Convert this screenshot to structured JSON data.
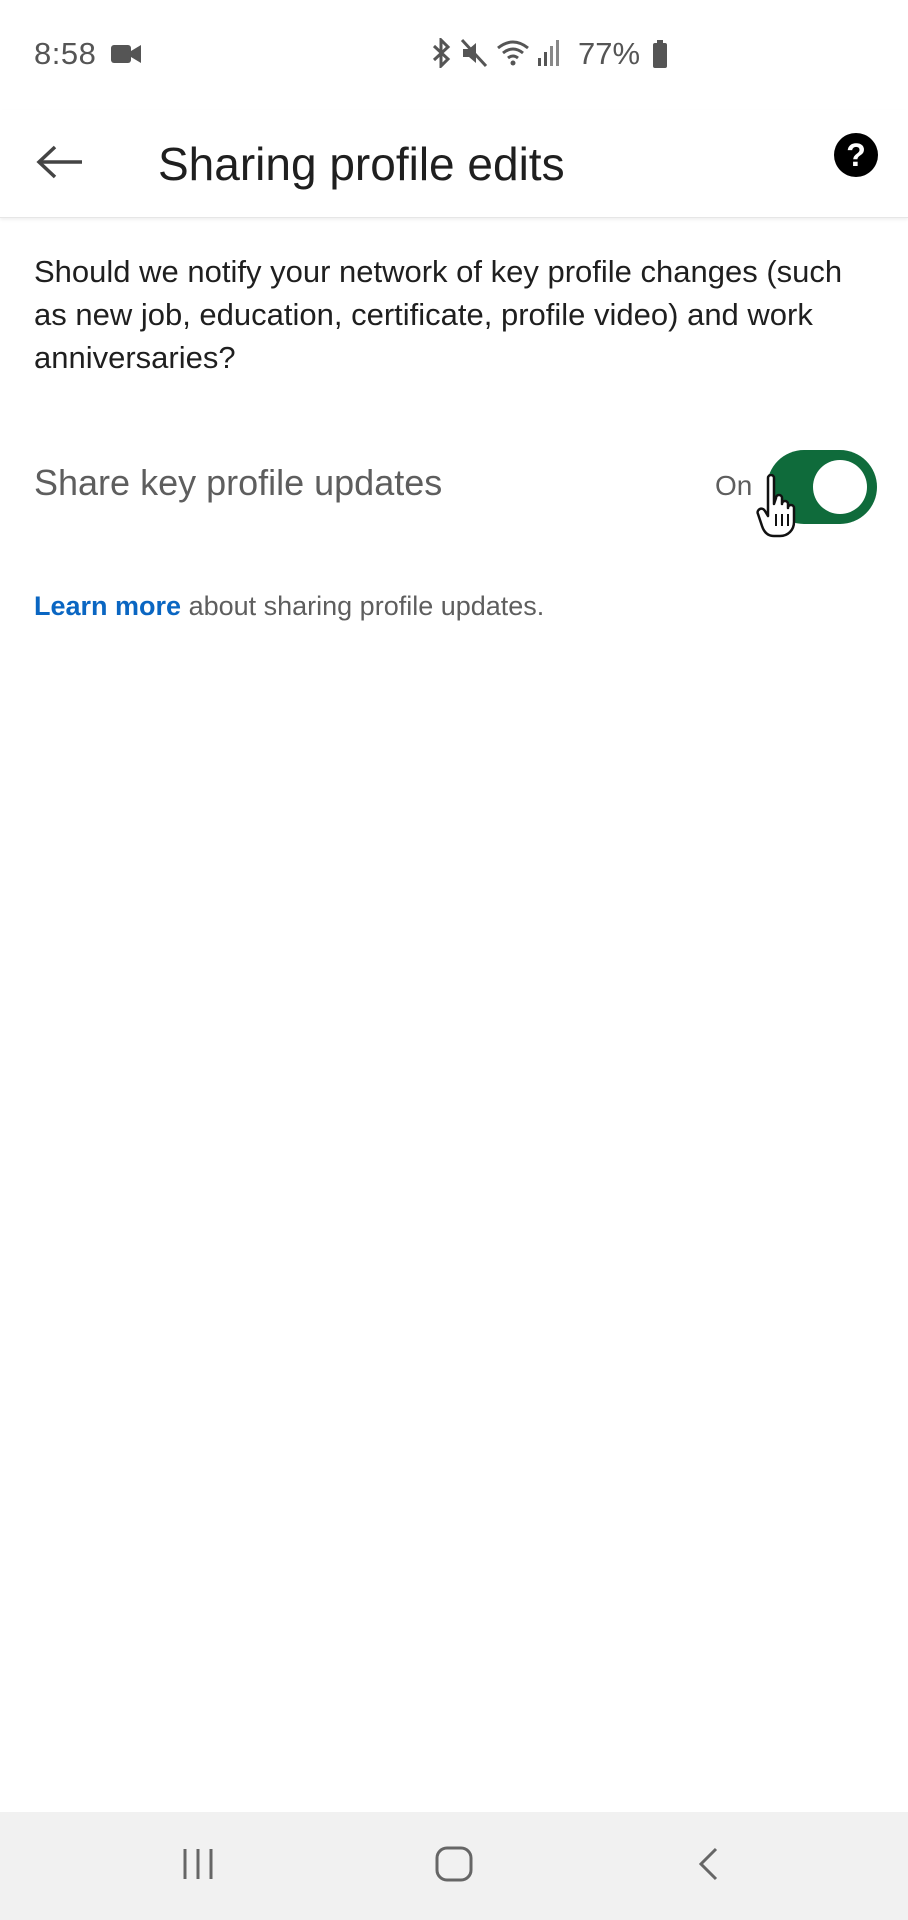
{
  "status_bar": {
    "time": "8:58",
    "battery": "77%",
    "icons": [
      "video-camera-icon",
      "bluetooth-icon",
      "mute-icon",
      "wifi-icon",
      "signal-icon",
      "battery-icon"
    ]
  },
  "app_bar": {
    "title": "Sharing profile edits",
    "back_icon": "arrow-left-icon",
    "help_label": "?"
  },
  "content": {
    "description": "Should we notify your network of key profile changes (such as new job, education, certificate, profile video) and work anniversaries?",
    "setting": {
      "label": "Share key profile updates",
      "state_label": "On",
      "enabled": true,
      "toggle_color": "#0f6b3b"
    },
    "learn_more": {
      "link_text": "Learn more",
      "rest_text": " about sharing profile updates."
    }
  },
  "nav_bar": {
    "icons": [
      "recent-apps-icon",
      "home-icon",
      "back-icon"
    ]
  },
  "colors": {
    "accent_link": "#0a66c2",
    "toggle_on": "#0f6b3b"
  }
}
